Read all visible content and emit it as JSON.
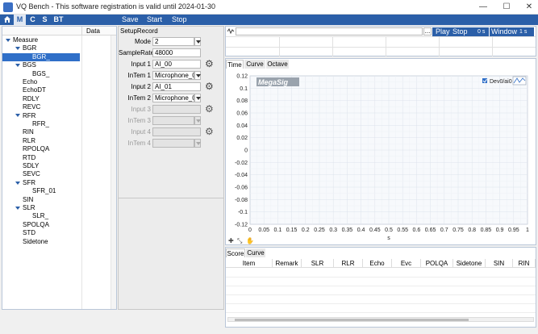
{
  "window": {
    "title": "VQ Bench - This software registration is valid until 2024-01-30",
    "min": "—",
    "max": "☐",
    "close": "✕"
  },
  "menubar": {
    "tabs": [
      "M",
      "C",
      "S",
      "BT"
    ],
    "items": [
      "Save",
      "Start",
      "Stop"
    ]
  },
  "tree": {
    "data_header": "Data",
    "nodes": [
      {
        "label": "Measure",
        "level": 0,
        "expand": true,
        "selected": false
      },
      {
        "label": "BGR",
        "level": 1,
        "expand": true,
        "selected": false
      },
      {
        "label": "BGR_",
        "level": 2,
        "expand": false,
        "selected": true
      },
      {
        "label": "BGS",
        "level": 1,
        "expand": true,
        "selected": false
      },
      {
        "label": "BGS_",
        "level": 2,
        "expand": false,
        "selected": false
      },
      {
        "label": "Echo",
        "level": 1,
        "expand": false,
        "selected": false
      },
      {
        "label": "EchoDT",
        "level": 1,
        "expand": false,
        "selected": false
      },
      {
        "label": "RDLY",
        "level": 1,
        "expand": false,
        "selected": false
      },
      {
        "label": "REVC",
        "level": 1,
        "expand": false,
        "selected": false
      },
      {
        "label": "RFR",
        "level": 1,
        "expand": true,
        "selected": false
      },
      {
        "label": "RFR_",
        "level": 2,
        "expand": false,
        "selected": false
      },
      {
        "label": "RIN",
        "level": 1,
        "expand": false,
        "selected": false
      },
      {
        "label": "RLR",
        "level": 1,
        "expand": false,
        "selected": false
      },
      {
        "label": "RPOLQA",
        "level": 1,
        "expand": false,
        "selected": false
      },
      {
        "label": "RTD",
        "level": 1,
        "expand": false,
        "selected": false
      },
      {
        "label": "SDLY",
        "level": 1,
        "expand": false,
        "selected": false
      },
      {
        "label": "SEVC",
        "level": 1,
        "expand": false,
        "selected": false
      },
      {
        "label": "SFR",
        "level": 1,
        "expand": true,
        "selected": false
      },
      {
        "label": "SFR_01",
        "level": 2,
        "expand": false,
        "selected": false
      },
      {
        "label": "SIN",
        "level": 1,
        "expand": false,
        "selected": false
      },
      {
        "label": "SLR",
        "level": 1,
        "expand": true,
        "selected": false
      },
      {
        "label": "SLR_",
        "level": 2,
        "expand": false,
        "selected": false
      },
      {
        "label": "SPOLQA",
        "level": 1,
        "expand": false,
        "selected": false
      },
      {
        "label": "STD",
        "level": 1,
        "expand": false,
        "selected": false
      },
      {
        "label": "Sidetone",
        "level": 1,
        "expand": false,
        "selected": false
      }
    ]
  },
  "setup": {
    "title": "SetupRecord",
    "rows": [
      {
        "label": "Mode",
        "value": "2",
        "type": "select",
        "enabled": true,
        "gear": false
      },
      {
        "label": "SampleRate",
        "value": "48000",
        "type": "text",
        "enabled": true,
        "gear": false
      },
      {
        "label": "Input 1",
        "value": "AI_00",
        "type": "text",
        "enabled": true,
        "gear": true
      },
      {
        "label": "InTem 1",
        "value": "Microphone_00_",
        "type": "select",
        "enabled": true,
        "gear": false
      },
      {
        "label": "Input 2",
        "value": "AI_01",
        "type": "text",
        "enabled": true,
        "gear": true
      },
      {
        "label": "InTem 2",
        "value": "Microphone_00_",
        "type": "select",
        "enabled": true,
        "gear": false
      },
      {
        "label": "Input 3",
        "value": "",
        "type": "text",
        "enabled": false,
        "gear": true
      },
      {
        "label": "InTem 3",
        "value": "",
        "type": "select",
        "enabled": false,
        "gear": false
      },
      {
        "label": "Input 4",
        "value": "",
        "type": "text",
        "enabled": false,
        "gear": true
      },
      {
        "label": "InTem 4",
        "value": "",
        "type": "select",
        "enabled": false,
        "gear": false
      }
    ]
  },
  "player": {
    "browse_label": "...",
    "play_label": "Play",
    "stop_label": "Stop",
    "time_label": "0 s",
    "window_label": "Window",
    "window_value": "1 s"
  },
  "chart_tabs": [
    "Time",
    "Curve",
    "Octave"
  ],
  "chart_logo": "MegaSig",
  "chart_data": {
    "type": "line",
    "title": "",
    "xlabel": "s",
    "ylabel": "",
    "xlim": [
      0,
      1
    ],
    "ylim": [
      -0.12,
      0.12
    ],
    "x_ticks": [
      "0",
      "0.05",
      "0.1",
      "0.15",
      "0.2",
      "0.25",
      "0.3",
      "0.35",
      "0.4",
      "0.45",
      "0.5",
      "0.55",
      "0.6",
      "0.65",
      "0.7",
      "0.75",
      "0.8",
      "0.85",
      "0.9",
      "0.95",
      "1"
    ],
    "y_ticks": [
      "0.12",
      "0.1",
      "0.08",
      "0.06",
      "0.04",
      "0.02",
      "0",
      "-0.02",
      "-0.04",
      "-0.06",
      "-0.08",
      "-0.1",
      "-0.12"
    ],
    "grid": true,
    "legend": "top-right",
    "series": [
      {
        "name": "Dev0/ai0",
        "values": []
      }
    ]
  },
  "score": {
    "tabs": [
      "Score",
      "Curve"
    ],
    "columns": [
      "Item",
      "Remark",
      "SLR",
      "RLR",
      "Echo",
      "Evc",
      "POLQA",
      "Sidetone",
      "SIN",
      "RIN"
    ]
  },
  "colors": {
    "accent": "#2b5fa8",
    "selection": "#2f6fc8"
  }
}
